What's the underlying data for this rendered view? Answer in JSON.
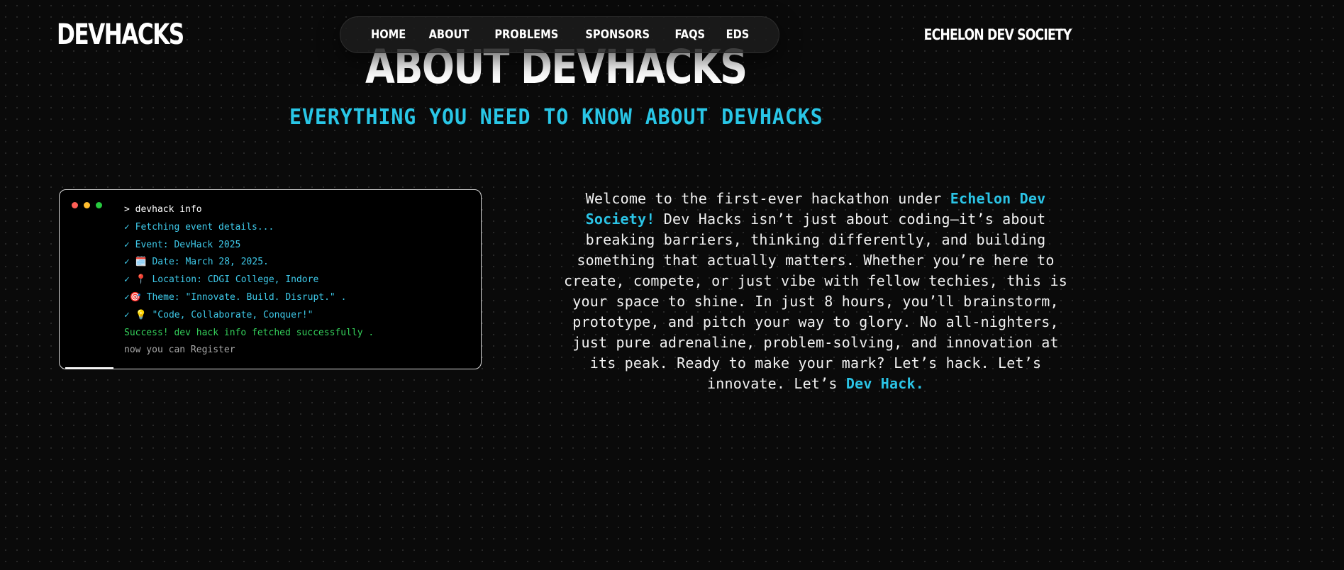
{
  "header": {
    "logo": "DEVHACKS",
    "org": "ECHELON DEV SOCIETY",
    "nav": [
      "HOME",
      "ABOUT",
      "PROBLEMS",
      "SPONSORS",
      "FAQS",
      "EDS"
    ]
  },
  "hero": {
    "title": "ABOUT DEVHACKS",
    "subtitle": "EVERYTHING YOU NEED TO KNOW ABOUT DEVHACKS"
  },
  "terminal": {
    "dots": [
      "#ff5f56",
      "#ffbd2e",
      "#27c93f"
    ],
    "command": "> devhack info",
    "check_mark": "✓",
    "lines": [
      {
        "icon": "",
        "text": "Fetching event details..."
      },
      {
        "icon": "",
        "text": "Event: DevHack 2025"
      },
      {
        "icon": "🗓️",
        "text": "Date: March 28, 2025."
      },
      {
        "icon": "📍",
        "text": "Location: CDGI College, Indore"
      },
      {
        "icon": "🎯",
        "text": "Theme: \"Innovate. Build. Disrupt.\" ."
      },
      {
        "icon": "💡",
        "text": "\"Code, Collaborate, Conquer!\""
      }
    ],
    "success": "Success! dev hack info fetched successfully .",
    "final": "now you can Register"
  },
  "description": {
    "intro": "Welcome to the first-ever hackathon under ",
    "highlight1": "Echelon Dev Society!",
    "body": " Dev Hacks isn’t just about coding—it’s about breaking barriers, thinking differently, and building something that actually matters. Whether you’re here to create, compete, or just vibe with fellow techies, this is your space to shine. In just 8 hours, you’ll brainstorm, prototype, and pitch your way to glory. No all-nighters, just pure adrenaline, problem-solving, and innovation at its peak. Ready to make your mark? Let’s hack. Let’s innovate. Let’s ",
    "highlight2": "Dev Hack."
  },
  "colors": {
    "accent": "#29c6e6",
    "success": "#34d05a",
    "background": "#0a0a0a"
  }
}
